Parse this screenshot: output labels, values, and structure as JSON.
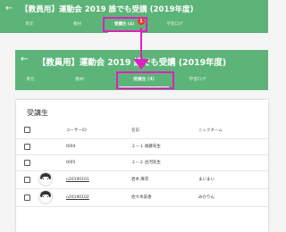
{
  "header": {
    "back_icon": "←",
    "title": "【教員用】運動会 2019 誰でも受講 (2019年度)",
    "tabs": [
      {
        "label": "単元"
      },
      {
        "label": "教材"
      },
      {
        "label": "受講生 (4)"
      },
      {
        "label": "学習ログ"
      }
    ],
    "badge": "1"
  },
  "zoom_header": {
    "back_icon": "←",
    "title": "【教員用】運動会 2019 誰でも受講 (2019年度)",
    "tabs": [
      {
        "label": "単元"
      },
      {
        "label": "教材"
      },
      {
        "label": "受講生 (4)"
      },
      {
        "label": "学習ログ"
      }
    ]
  },
  "students": {
    "section_title": "受講生",
    "columns": [
      "ユーザーID",
      "名前",
      "ニックネーム"
    ],
    "rows": [
      {
        "id": "t004",
        "name": "２－１ 後藤先生",
        "nickname": "",
        "avatar": false,
        "link": false
      },
      {
        "id": "t005",
        "name": "２－２ 古河先生",
        "nickname": "",
        "avatar": false,
        "link": false
      },
      {
        "id": "n20190101",
        "name": "岩木 麻衣",
        "nickname": "まいまい",
        "avatar": true,
        "link": true
      },
      {
        "id": "n20190102",
        "name": "佐々木美香",
        "nickname": "みかりん",
        "avatar": true,
        "link": true
      }
    ]
  },
  "colors": {
    "header_green": "#5cb478",
    "highlight_magenta": "#e020c0",
    "badge_red": "#e53935"
  }
}
